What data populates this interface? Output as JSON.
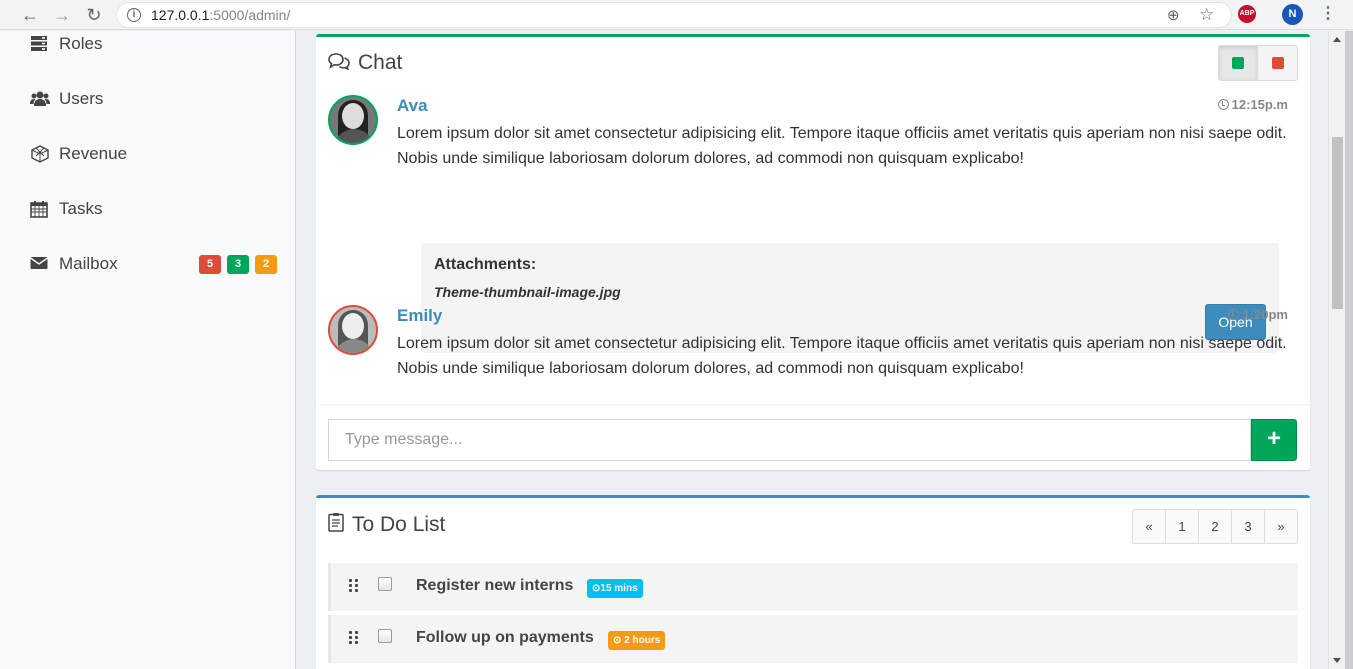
{
  "browser": {
    "url_host": "127.0.0.1",
    "url_rest": ":5000/admin/",
    "profile_initial": "N",
    "extension_label": "ABP"
  },
  "sidebar": {
    "items": [
      {
        "label": "Roles",
        "icon": "server-icon"
      },
      {
        "label": "Users",
        "icon": "users-icon"
      },
      {
        "label": "Revenue",
        "icon": "cube-icon"
      },
      {
        "label": "Tasks",
        "icon": "calendar-icon"
      },
      {
        "label": "Mailbox",
        "icon": "envelope-icon",
        "badges": [
          {
            "text": "5",
            "color": "#dd4b39"
          },
          {
            "text": "3",
            "color": "#00a65a"
          },
          {
            "text": "2",
            "color": "#f39c12"
          }
        ]
      }
    ]
  },
  "chat": {
    "title": "Chat",
    "accent_color": "#00a65a",
    "status_colors": [
      "#00a65a",
      "#dd4b39"
    ],
    "messages": [
      {
        "name": "Ava",
        "time": "12:15p.m",
        "text": "Lorem ipsum dolor sit amet consectetur adipisicing elit. Tempore itaque officiis amet veritatis quis aperiam non nisi saepe odit. Nobis unde similique laboriosam dolorum dolores, ad commodi non quisquam explicabo!",
        "avatar_border": "#00a65a",
        "attachment": {
          "title": "Attachments:",
          "file": "Theme-thumbnail-image.jpg",
          "button": "Open"
        }
      },
      {
        "name": "Emily",
        "time": "1:20pm",
        "text": "Lorem ipsum dolor sit amet consectetur adipisicing elit. Tempore itaque officiis amet veritatis quis aperiam non nisi saepe odit. Nobis unde similique laboriosam dolorum dolores, ad commodi non quisquam explicabo!",
        "avatar_border": "#dd4b39"
      }
    ],
    "input_placeholder": "Type message...",
    "add_button": "+"
  },
  "todo": {
    "title": "To Do List",
    "pager": [
      "«",
      "1",
      "2",
      "3",
      "»"
    ],
    "items": [
      {
        "text": "Register new interns",
        "label": "15 mins",
        "label_color": "#00c0ef"
      },
      {
        "text": "Follow up on payments",
        "label": "2 hours",
        "label_color": "#f39c12"
      }
    ]
  }
}
